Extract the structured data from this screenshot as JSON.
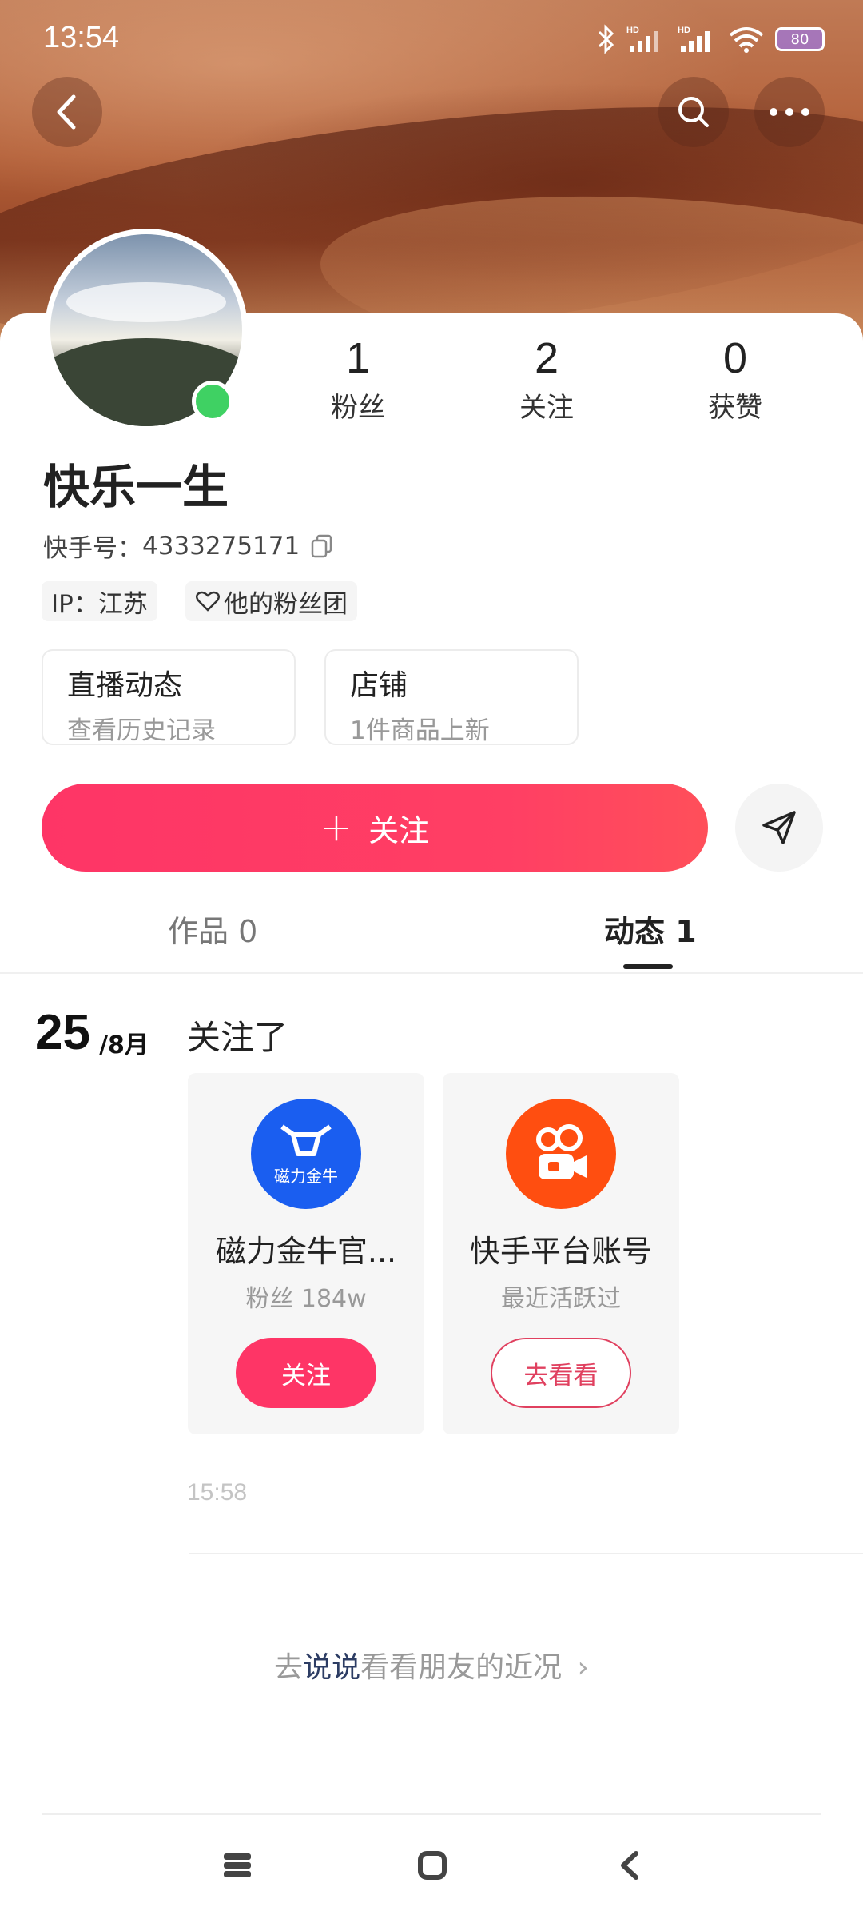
{
  "status_bar": {
    "time": "13:54",
    "battery": "80"
  },
  "profile": {
    "name": "快乐一生",
    "account_label": "快手号：",
    "account_id": "4333275171",
    "stats": [
      {
        "value": "1",
        "label": "粉丝"
      },
      {
        "value": "2",
        "label": "关注"
      },
      {
        "value": "0",
        "label": "获赞"
      }
    ],
    "tags": {
      "ip": "IP：江苏",
      "fan_club": "他的粉丝团"
    },
    "info_boxes": [
      {
        "title": "直播动态",
        "subtitle": "查看历史记录"
      },
      {
        "title": "店铺",
        "subtitle": "1件商品上新"
      }
    ],
    "follow_button": {
      "plus": "+",
      "label": "关注"
    }
  },
  "tabs": [
    {
      "label": "作品 0"
    },
    {
      "label": "动态 1"
    }
  ],
  "feed": {
    "day": "25",
    "month": "/8月",
    "title": "关注了",
    "cards": [
      {
        "name": "磁力金牛官...",
        "avatar_text": "磁力金牛",
        "subtitle": "粉丝 184w",
        "button": "关注"
      },
      {
        "name": "快手平台账号",
        "subtitle": "最近活跃过",
        "button": "去看看"
      }
    ],
    "time": "15:58"
  },
  "say_link": {
    "prefix": "去",
    "emphasis": "说说",
    "suffix": "看看朋友的近况",
    "arrow": "›"
  },
  "colors": {
    "accent": "#fe3566",
    "online": "#3fd163",
    "cili_blue": "#1a5ef0",
    "kuaishou_orange": "#ff4e10"
  }
}
